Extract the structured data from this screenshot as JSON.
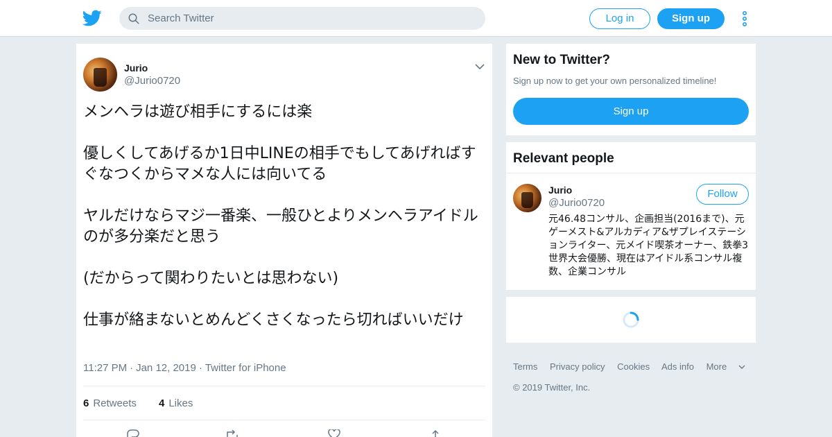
{
  "topbar": {
    "logo_icon": "twitter-bird-icon",
    "search_placeholder": "Search Twitter",
    "login_label": "Log in",
    "signup_label": "Sign up",
    "more_icon": "more-vertical-icon"
  },
  "tweet": {
    "author_name": "Jurio",
    "author_handle": "@Jurio0720",
    "text": "メンヘラは遊び相手にするには楽\n\n優しくしてあげるか1日中LINEの相手でもしてあげればすぐなつくからマメな人には向いてる\n\nヤルだけならマジ一番楽、一般ひとよりメンヘラアイドルのが多分楽だと思う\n\n(だからって関わりたいとは思わない)\n\n仕事が絡まないとめんどくさくなったら切ればいいだけ",
    "time": "11:27 PM",
    "date": "Jan 12, 2019",
    "source": "Twitter for iPhone",
    "retweets_count": "6",
    "retweets_label": "Retweets",
    "likes_count": "4",
    "likes_label": "Likes",
    "action_icons": [
      "reply-icon",
      "retweet-icon",
      "like-icon",
      "share-icon"
    ]
  },
  "signup_panel": {
    "heading": "New to Twitter?",
    "subtext": "Sign up now to get your own personalized timeline!",
    "button_label": "Sign up"
  },
  "relevant_people": {
    "heading": "Relevant people",
    "person": {
      "name": "Jurio",
      "handle": "@Jurio0720",
      "follow_label": "Follow",
      "bio": "元46.48コンサル、企画担当(2016まで)、元ゲーメスト&アルカディア&ザプレイステーションライター、元メイド喫茶オーナー、鉄拳3世界大会優勝、現在はアイドル系コンサル複数、企業コンサル"
    }
  },
  "footer": {
    "links": [
      "Terms",
      "Privacy policy",
      "Cookies",
      "Ads info",
      "More"
    ],
    "copyright": "© 2019 Twitter, Inc."
  },
  "colors": {
    "accent": "#1da1f2",
    "background": "#e6ecf0",
    "secondary_text": "#657786"
  }
}
